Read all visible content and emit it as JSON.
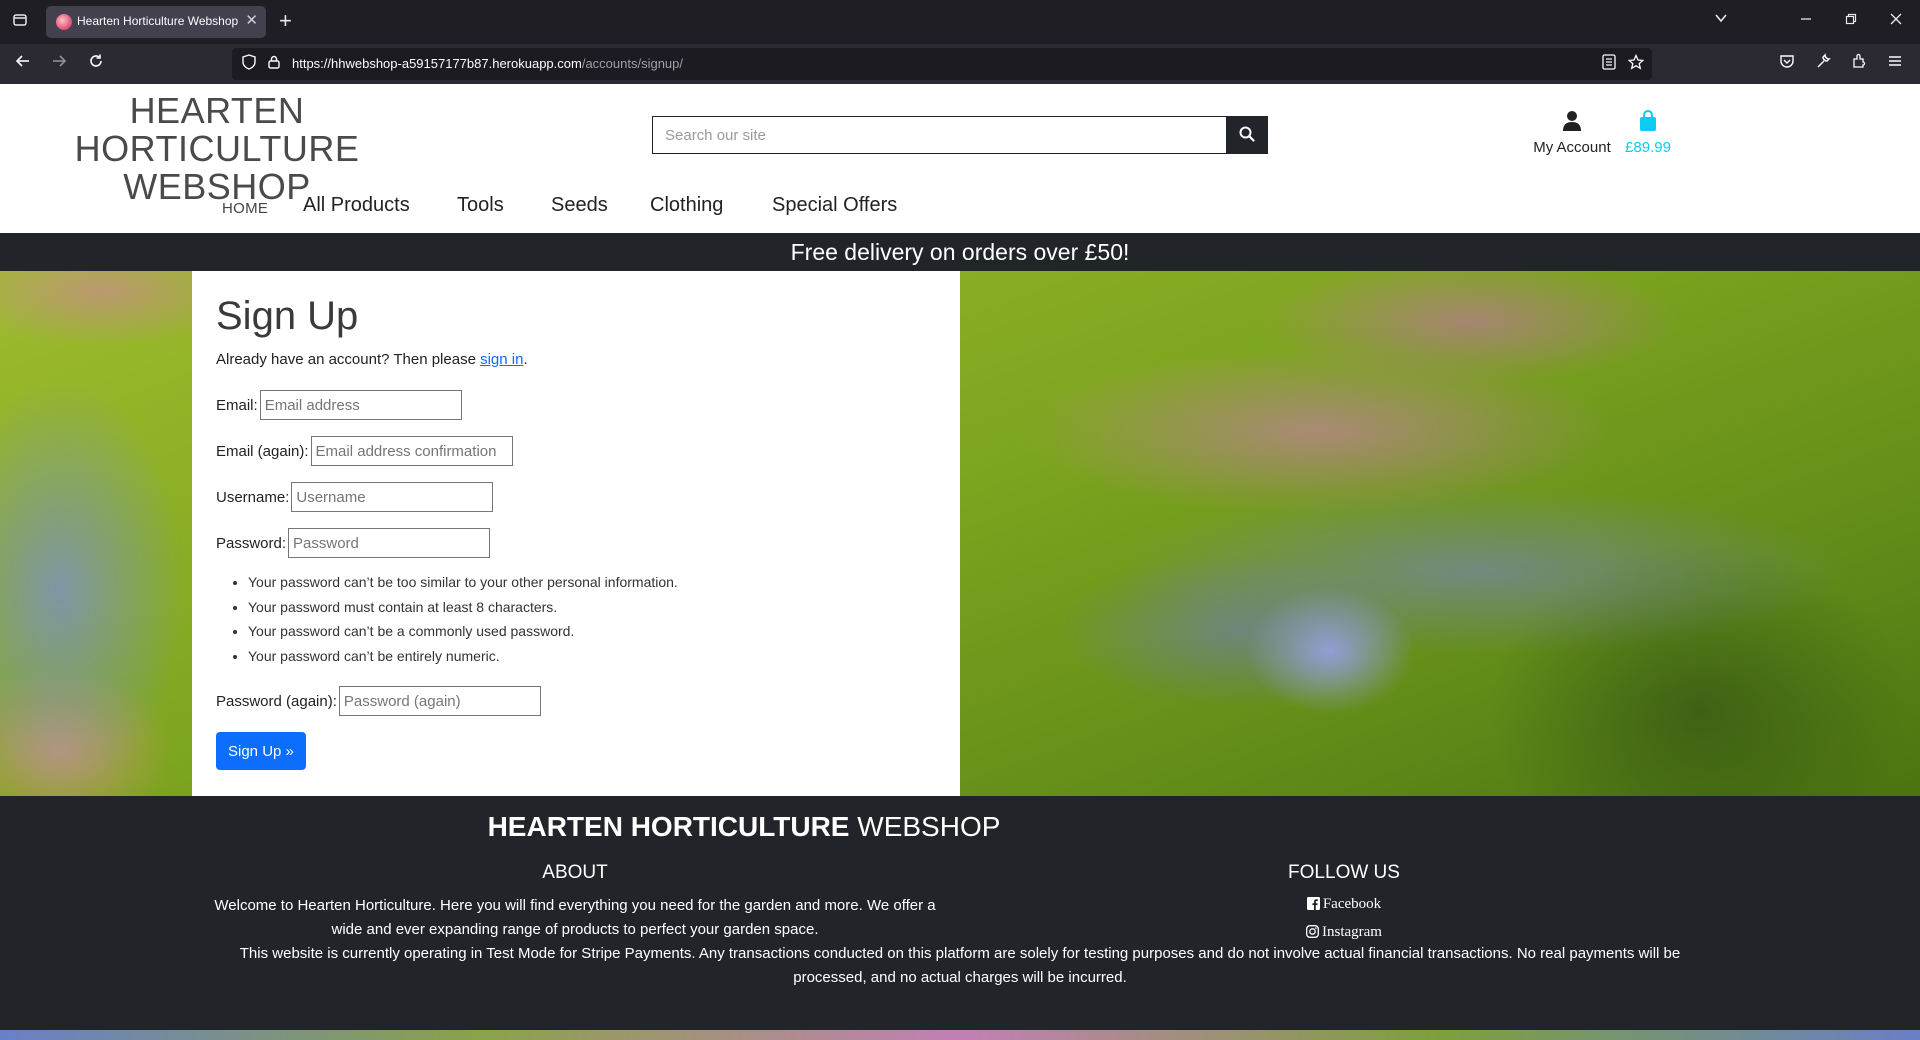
{
  "browser": {
    "tab_title": "Hearten Horticulture Webshop",
    "url_host": "https://hhwebshop-a59157177b87.herokuapp.com",
    "url_path": "/accounts/signup/"
  },
  "header": {
    "logo_line1": "HEARTEN HORTICULTURE",
    "logo_line2": "WEBSHOP",
    "search_placeholder": "Search our site",
    "account_label": "My Account",
    "bag_total": "£89.99",
    "bag_color": "#0dcaf0"
  },
  "nav": {
    "home": "HOME",
    "all_products": "All Products",
    "tools": "Tools",
    "seeds": "Seeds",
    "clothing": "Clothing",
    "special_offers": "Special Offers"
  },
  "banner": {
    "text": "Free delivery on orders over £50!"
  },
  "signup": {
    "title": "Sign Up",
    "intro_prefix": "Already have an account? Then please ",
    "intro_link": "sign in",
    "intro_suffix": ".",
    "email_label": "Email:",
    "email_placeholder": "Email address",
    "email2_label": "Email (again):",
    "email2_placeholder": "Email address confirmation",
    "username_label": "Username:",
    "username_placeholder": "Username",
    "password_label": "Password:",
    "password_placeholder": "Password",
    "password_help": [
      "Your password can’t be too similar to your other personal information.",
      "Your password must contain at least 8 characters.",
      "Your password can’t be a commonly used password.",
      "Your password can’t be entirely numeric."
    ],
    "password2_label": "Password (again):",
    "password2_placeholder": "Password (again)",
    "submit_label": "Sign Up »",
    "button_color": "#0d6efd"
  },
  "footer": {
    "title_bold": "HEARTEN HORTICULTURE",
    "title_rest": " WEBSHOP",
    "about_heading": "ABOUT",
    "about_text": "Welcome to Hearten Horticulture. Here you will find everything you need for the garden and more. We offer a wide and ever expanding range of products to perfect your garden space.",
    "follow_heading": "FOLLOW US",
    "facebook": "Facebook",
    "instagram": "Instagram",
    "notice": "This website is currently operating in Test Mode for Stripe Payments. Any transactions conducted on this platform are solely for testing purposes and do not involve actual financial transactions. No real payments will be processed, and no actual charges will be incurred."
  },
  "icons": {
    "tab_list": "tab-list-icon",
    "back": "arrow-left-icon",
    "forward": "arrow-right-icon",
    "reload": "reload-icon",
    "shield": "shield-icon",
    "lock": "lock-icon",
    "reader": "reader-view-icon",
    "bookmark": "star-icon",
    "pocket": "pocket-icon",
    "tools": "wrench-icon",
    "extensions": "extensions-icon",
    "menu": "hamburger-menu-icon",
    "search": "search-icon",
    "user": "user-icon",
    "bag": "shopping-bag-icon",
    "facebook": "facebook-icon",
    "instagram": "instagram-icon"
  }
}
